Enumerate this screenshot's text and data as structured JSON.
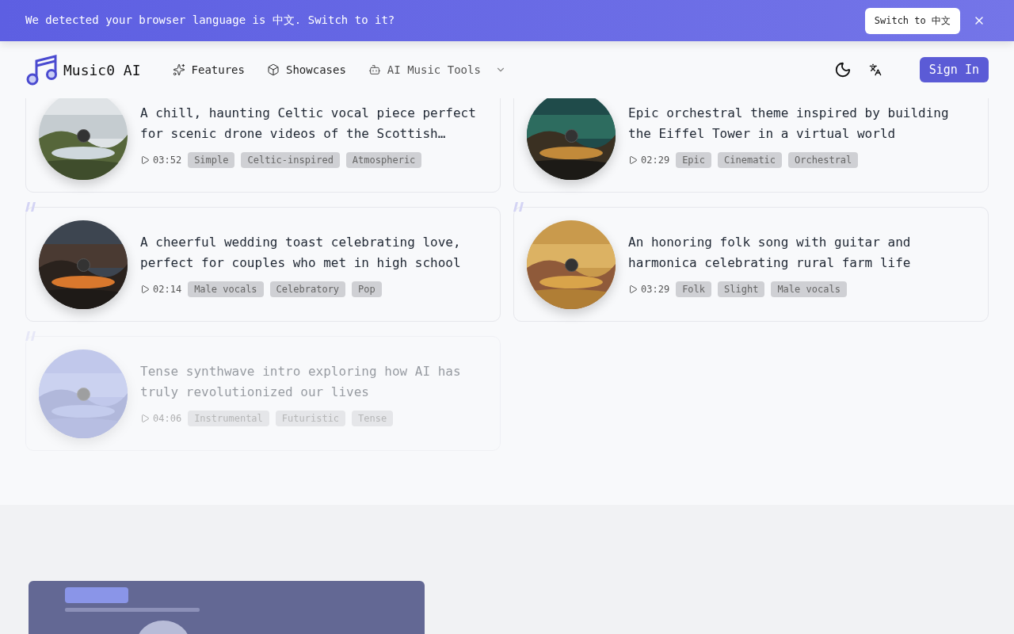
{
  "banner": {
    "message": "We detected your browser language is 中文. Switch to it?",
    "switch_button": "Switch to 中文"
  },
  "nav": {
    "brand": "Music0 AI",
    "links": [
      {
        "label": "Features",
        "kind": "sparkles",
        "dropdown": false
      },
      {
        "label": "Showcases",
        "kind": "box",
        "dropdown": false
      },
      {
        "label": "AI Music Tools",
        "kind": "bot",
        "dropdown": true
      }
    ],
    "sign_in": "Sign In"
  },
  "tracks": [
    {
      "title": "A chill, haunting Celtic vocal piece perfect for scenic drone videos of the Scottish…",
      "duration": "03:52",
      "tags": [
        "Simple",
        "Celtic-inspired",
        "Atmospheric"
      ],
      "dimmed": false
    },
    {
      "title": "Epic orchestral theme inspired by building the Eiffel Tower in a virtual world",
      "duration": "02:29",
      "tags": [
        "Epic",
        "Cinematic",
        "Orchestral"
      ],
      "dimmed": false
    },
    {
      "title": "A cheerful wedding toast celebrating love, perfect for couples who met in high school",
      "duration": "02:14",
      "tags": [
        "Male vocals",
        "Celebratory",
        "Pop"
      ],
      "dimmed": false
    },
    {
      "title": "An honoring folk song with guitar and harmonica celebrating rural farm life",
      "duration": "03:29",
      "tags": [
        "Folk",
        "Slight",
        "Male vocals"
      ],
      "dimmed": false
    },
    {
      "title": "Tense synthwave intro exploring how AI has truly revolutionized our lives",
      "duration": "04:06",
      "tags": [
        "Instrumental",
        "Futuristic",
        "Tense"
      ],
      "dimmed": true
    }
  ]
}
